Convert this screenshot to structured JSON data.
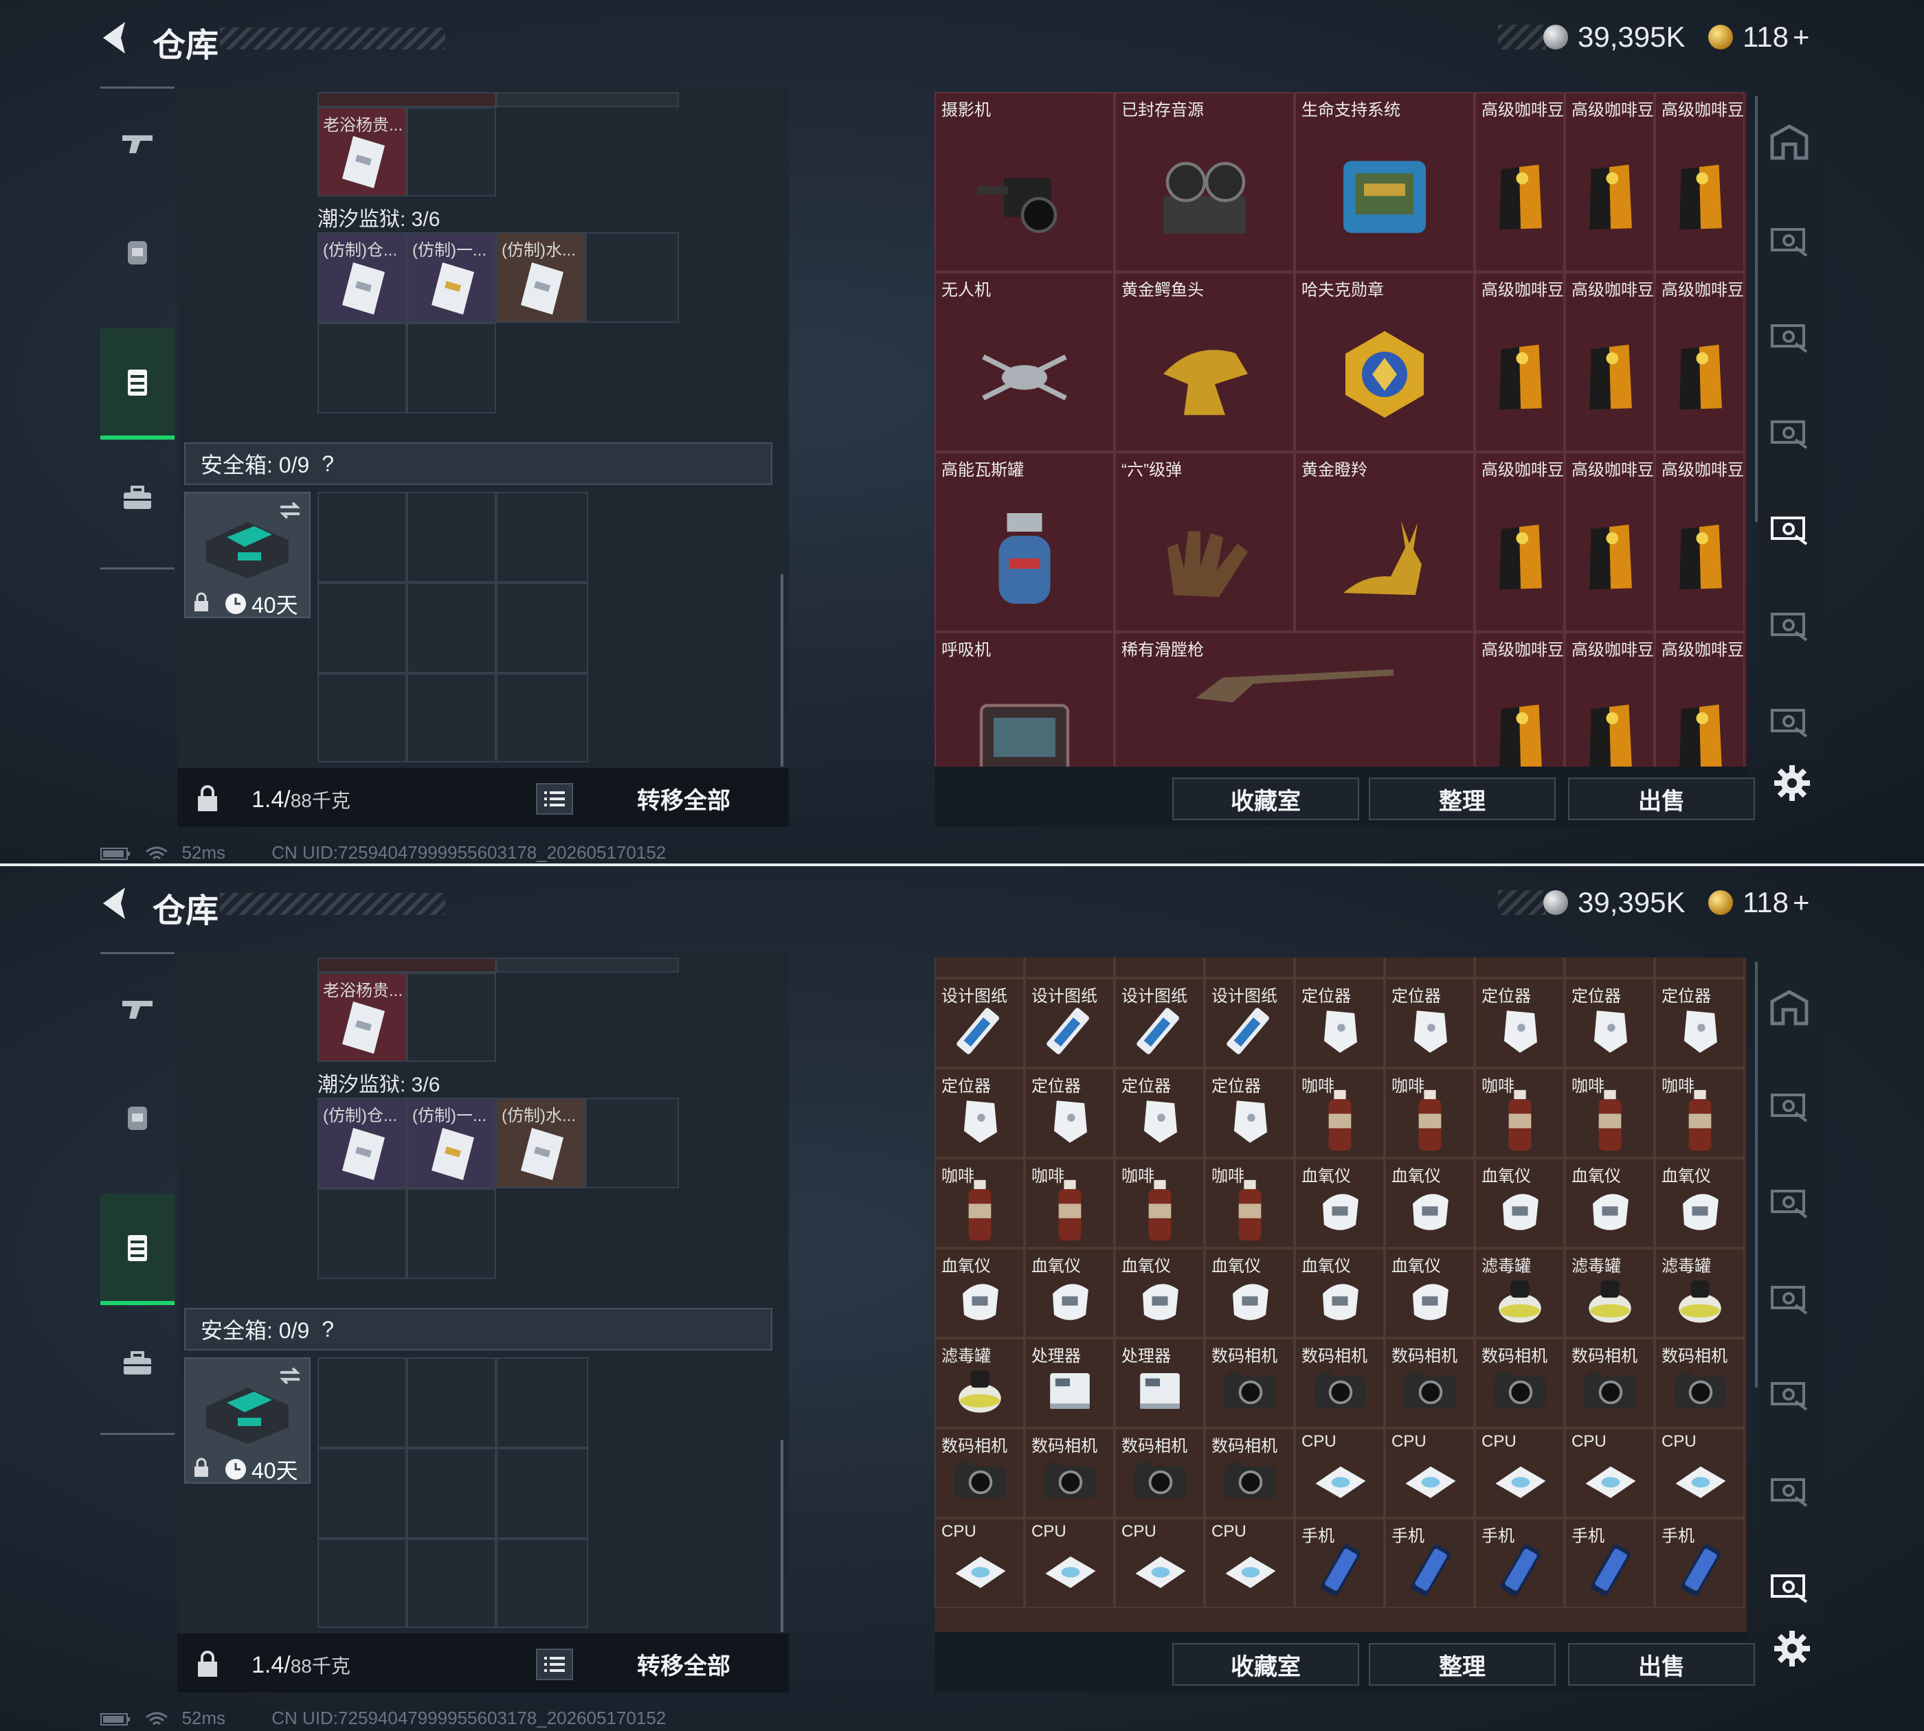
{
  "header": {
    "title": "仓库",
    "currency_silver": "39,395K",
    "currency_gold": "118",
    "gold_add": "+"
  },
  "side_tabs": [
    "gun-icon",
    "backpack-icon",
    "container-icon",
    "case-icon"
  ],
  "container": {
    "top_item_label": "老浴杨贵...",
    "sub_title": "潮汐监狱: 3/6",
    "sub_items": [
      "(仿制)仓...",
      "(仿制)一...",
      "(仿制)水..."
    ],
    "safe_label": "安全箱: 0/9",
    "safe_help": "?",
    "case_days": "40天",
    "weight_value": "1.4/",
    "weight_max": "88千克",
    "transfer_all": "转移全部"
  },
  "status": {
    "ping": "52ms",
    "uid": "CN UID:72594047999955603178_202605170152"
  },
  "actions": {
    "collection": "收藏室",
    "sort": "整理",
    "sell": "出售"
  },
  "stash_top": {
    "items": [
      {
        "label": "摄影机",
        "icon": "camcorder-icon"
      },
      {
        "label": "已封存音源",
        "icon": "tape-recorder-icon"
      },
      {
        "label": "生命支持系统",
        "icon": "life-support-icon"
      },
      {
        "label": "无人机",
        "icon": "drone-icon"
      },
      {
        "label": "黄金鳄鱼头",
        "icon": "gold-croc-icon"
      },
      {
        "label": "哈夫克勋章",
        "icon": "medal-icon"
      },
      {
        "label": "高能瓦斯罐",
        "icon": "gas-tank-icon"
      },
      {
        "label": "“六”级弹",
        "icon": "hand-icon"
      },
      {
        "label": "黄金瞪羚",
        "icon": "gold-gazelle-icon"
      },
      {
        "label": "呼吸机",
        "icon": "ventilator-icon"
      },
      {
        "label": "稀有滑膛枪",
        "icon": "musket-icon"
      }
    ],
    "coffee_label": "高级咖啡豆"
  },
  "stash_bottom": {
    "rows": [
      [
        "设计图纸",
        "设计图纸",
        "设计图纸",
        "设计图纸",
        "定位器",
        "定位器",
        "定位器",
        "定位器",
        "定位器"
      ],
      [
        "定位器",
        "定位器",
        "定位器",
        "定位器",
        "咖啡",
        "咖啡",
        "咖啡",
        "咖啡",
        "咖啡"
      ],
      [
        "咖啡",
        "咖啡",
        "咖啡",
        "咖啡",
        "血氧仪",
        "血氧仪",
        "血氧仪",
        "血氧仪",
        "血氧仪"
      ],
      [
        "血氧仪",
        "血氧仪",
        "血氧仪",
        "血氧仪",
        "血氧仪",
        "血氧仪",
        "滤毒罐",
        "滤毒罐",
        "滤毒罐"
      ],
      [
        "滤毒罐",
        "处理器",
        "处理器",
        "数码相机",
        "数码相机",
        "数码相机",
        "数码相机",
        "数码相机",
        "数码相机"
      ],
      [
        "数码相机",
        "数码相机",
        "数码相机",
        "数码相机",
        "CPU",
        "CPU",
        "CPU",
        "CPU",
        "CPU"
      ],
      [
        "CPU",
        "CPU",
        "CPU",
        "CPU",
        "手机",
        "手机",
        "手机",
        "手机",
        "手机"
      ]
    ]
  },
  "colors": {
    "accent_green": "#1ed36c",
    "stash_red": "#4b1f27",
    "stash_brown": "#3d2a24"
  }
}
